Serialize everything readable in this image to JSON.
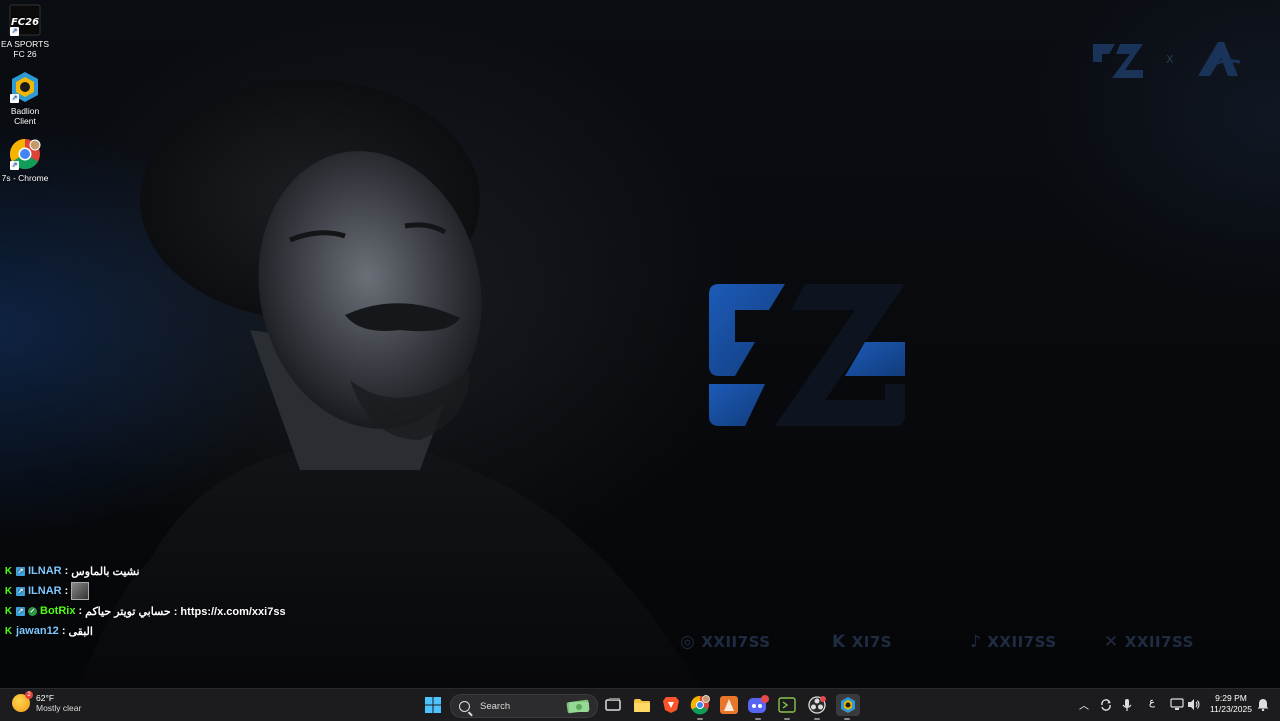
{
  "desktop": {
    "icons": [
      {
        "label": "EA SPORTS FC 26",
        "icon": "fc26-icon"
      },
      {
        "label": "Badlion Client",
        "icon": "badlion-icon"
      },
      {
        "label": "7s - Chrome",
        "icon": "chrome-icon"
      }
    ]
  },
  "wallpaper": {
    "corner_x": "X",
    "socials": [
      {
        "icon": "instagram-icon",
        "handle": "XXII7SS"
      },
      {
        "icon": "kick-icon",
        "handle": "XI7S"
      },
      {
        "icon": "tiktok-icon",
        "handle": "XXII7SS"
      },
      {
        "icon": "x-icon",
        "handle": "XXII7SS"
      }
    ],
    "accent": "#1a4fa3"
  },
  "chat": {
    "messages": [
      {
        "user": "ILNAR",
        "separator": " : ",
        "text": "نشيت بالماوس"
      },
      {
        "user": "ILNAR",
        "separator": " : ",
        "text": ""
      },
      {
        "user": "BotRix",
        "separator": " : ",
        "text": "حسابي تويتر حياكم : https://x.com/xxi7ss"
      },
      {
        "user": "jawan12",
        "separator": " : ",
        "text": "البقى"
      }
    ]
  },
  "taskbar": {
    "weather": {
      "temp": "62°F",
      "condition": "Mostly clear",
      "badge": "2"
    },
    "search_label": "Search",
    "tray": {
      "language": "ع"
    },
    "clock": {
      "time": "9:29 PM",
      "date": "11/23/2025"
    }
  }
}
